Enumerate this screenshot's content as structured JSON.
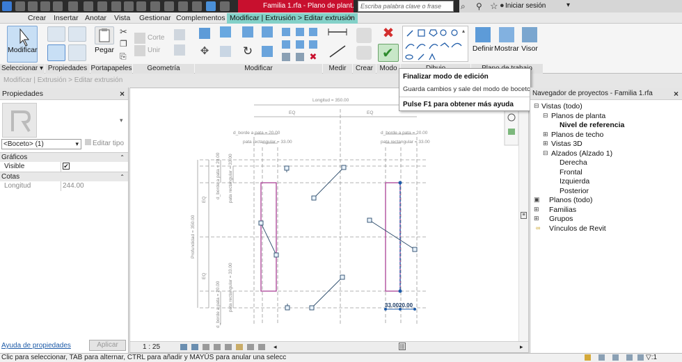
{
  "titlebar": {
    "document_title": "Familia 1.rfa - Plano de plant...",
    "search_placeholder": "Escriba palabra clave o frase",
    "signin_label": "Iniciar sesión"
  },
  "tabs": [
    {
      "label": "Crear"
    },
    {
      "label": "Insertar"
    },
    {
      "label": "Anotar"
    },
    {
      "label": "Vista"
    },
    {
      "label": "Gestionar"
    },
    {
      "label": "Complementos"
    },
    {
      "label": "Modificar | Extrusión > Editar extrusión"
    }
  ],
  "ribbon": {
    "modify_label": "Modificar",
    "paste_label": "Pegar",
    "cut_label": "Corte",
    "join_label": "Unir",
    "define_label": "Definir",
    "show_label": "Mostrar",
    "viewer_label": "Visor",
    "panels": {
      "select": "Seleccionar",
      "properties": "Propiedades",
      "clipboard": "Portapapeles",
      "geometry": "Geometría",
      "modify": "Modificar",
      "measure": "Medir",
      "create": "Crear",
      "mode": "Modo",
      "draw": "Dibujo",
      "workplane": "Plano de trabajo"
    }
  },
  "optionsbar": {
    "breadcrumb": "Modificar | Extrusión > Editar extrusión"
  },
  "tooltip": {
    "title": "Finalizar modo de edición",
    "description": "Guarda cambios y sale del modo de boceto.",
    "help": "Pulse F1 para obtener más ayuda"
  },
  "properties": {
    "header": "Propiedades",
    "type_selector": "<Boceto> (1)",
    "edit_type": "Editar tipo",
    "sections": [
      {
        "label": "Gráficos"
      },
      {
        "label": "Cotas"
      }
    ],
    "rows": [
      {
        "name": "Visible",
        "value": "✔"
      },
      {
        "name": "Longitud",
        "value": "244.00"
      }
    ],
    "help_link": "Ayuda de propiedades",
    "apply_label": "Aplicar"
  },
  "view": {
    "scale": "1 : 25",
    "dims": {
      "length": "Longitud = 350.00",
      "eq": "EQ",
      "edge_leg": "d_borde a pata = 20.00",
      "leg_rect": "pata rectangular = 33.00",
      "depth": "Profundidad = 350.00",
      "d_33": "33.00",
      "d_20": "20.00"
    }
  },
  "browser": {
    "header": "Navegador de proyectos - Familia 1.rfa",
    "tree": [
      {
        "label": "Vistas (todo)"
      },
      {
        "label": "Planos de planta"
      },
      {
        "label": "Nivel de referencia"
      },
      {
        "label": "Planos de techo"
      },
      {
        "label": "Vistas 3D"
      },
      {
        "label": "Alzados (Alzado 1)"
      },
      {
        "label": "Derecha"
      },
      {
        "label": "Frontal"
      },
      {
        "label": "Izquierda"
      },
      {
        "label": "Posterior"
      },
      {
        "label": "Planos (todo)"
      },
      {
        "label": "Familias"
      },
      {
        "label": "Grupos"
      },
      {
        "label": "Vínculos de Revit"
      }
    ]
  },
  "statusbar": {
    "text": "Clic para seleccionar, TAB para alternar, CTRL para añadir y MAYÚS para anular una selecc",
    "filter_count": ":1"
  },
  "colors": {
    "accent_tab": "#83d1c8",
    "title_red": "#c8102e",
    "sketch_magenta": "#a3338e",
    "dimension_gray": "#8a8a8a"
  }
}
